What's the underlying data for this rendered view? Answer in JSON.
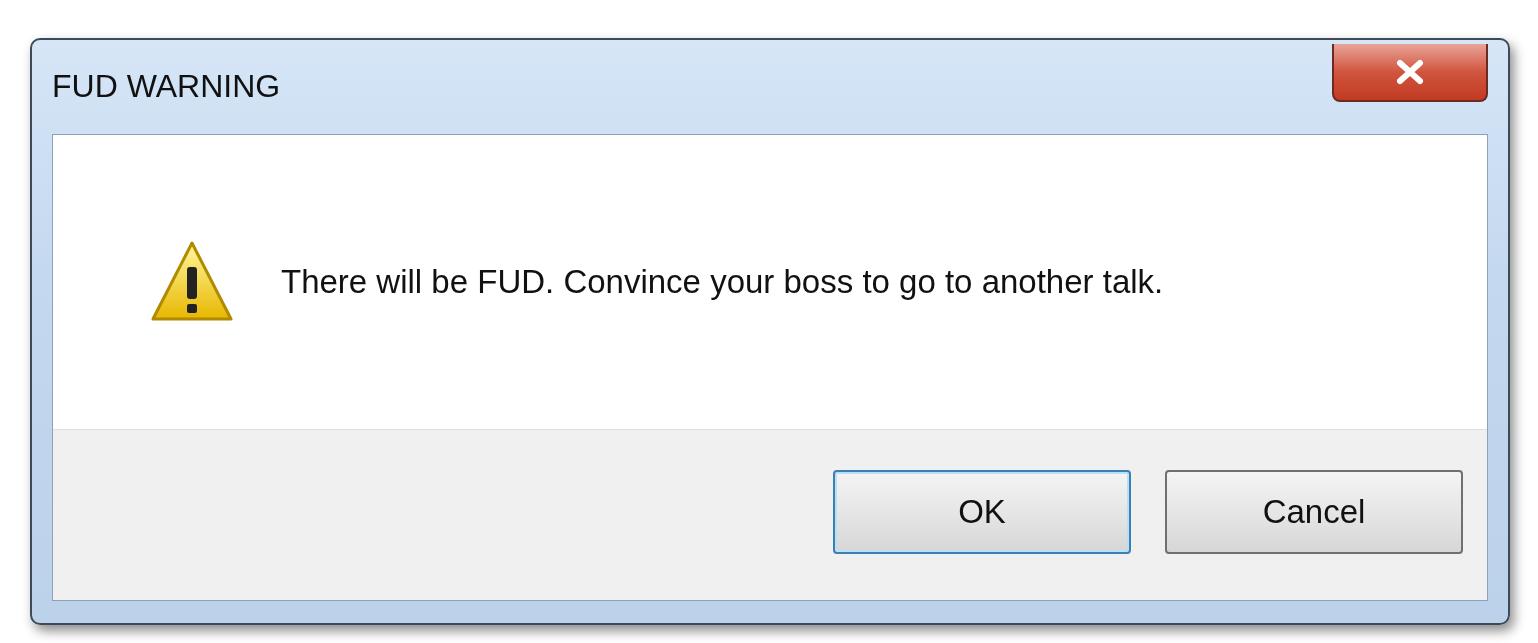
{
  "window": {
    "title": "FUD WARNING"
  },
  "message": "There will be FUD. Convince your boss to go to another talk.",
  "buttons": [
    {
      "label": "OK",
      "default": true
    },
    {
      "label": "Cancel",
      "default": false
    }
  ]
}
